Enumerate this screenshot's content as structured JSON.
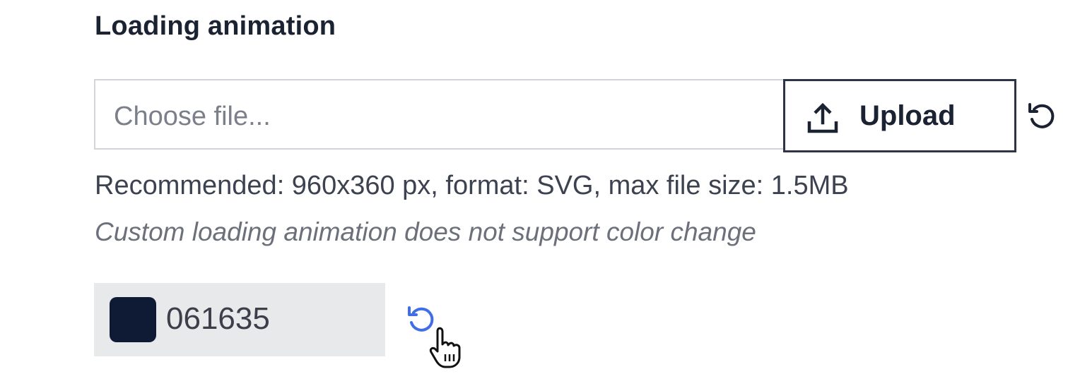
{
  "section": {
    "title": "Loading animation"
  },
  "file_input": {
    "placeholder": "Choose file...",
    "upload_label": "Upload",
    "upload_icon": "upload-icon",
    "reset_icon": "reset-icon"
  },
  "hint": "Recommended: 960x360 px, format: SVG, max file size: 1.5MB",
  "note": "Custom loading animation does not support color change",
  "color": {
    "value": "061635",
    "swatch_color": "#0f1a35",
    "reset_icon": "reset-icon",
    "reset_icon_color": "#3f6ee8"
  }
}
